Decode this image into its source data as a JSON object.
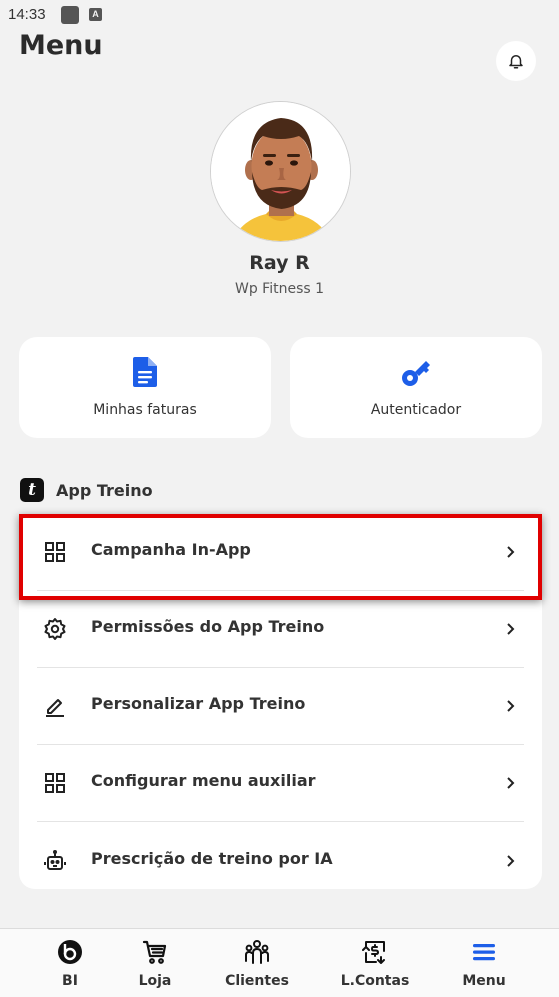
{
  "status_bar": {
    "time": "14:33",
    "badge_letter": "A"
  },
  "header": {
    "title": "Menu",
    "bell_icon": "bell-icon"
  },
  "profile": {
    "name": "Ray R",
    "company": "Wp Fitness 1"
  },
  "quick_cards": [
    {
      "label": "Minhas faturas",
      "icon": "document-icon"
    },
    {
      "label": "Autenticador",
      "icon": "key-icon"
    }
  ],
  "section": {
    "logo_letter": "t",
    "title": "App Treino"
  },
  "menu_items": [
    {
      "label": "Campanha In-App",
      "icon": "grid-icon",
      "highlighted": true
    },
    {
      "label": "Permissões do App Treino",
      "icon": "gear-icon"
    },
    {
      "label": "Personalizar App Treino",
      "icon": "pencil-icon"
    },
    {
      "label": "Configurar menu auxiliar",
      "icon": "grid-icon"
    },
    {
      "label": "Prescrição de treino por IA",
      "icon": "robot-icon"
    }
  ],
  "bottom_nav": [
    {
      "label": "BI",
      "icon": "bi-icon"
    },
    {
      "label": "Loja",
      "icon": "cart-icon"
    },
    {
      "label": "Clientes",
      "icon": "people-icon"
    },
    {
      "label": "L.Contas",
      "icon": "accounts-icon"
    },
    {
      "label": "Menu",
      "icon": "menu-icon",
      "active": true
    }
  ],
  "colors": {
    "accent": "#1d5ee8",
    "highlight_border": "#e00000",
    "background": "#f2f2f2"
  }
}
